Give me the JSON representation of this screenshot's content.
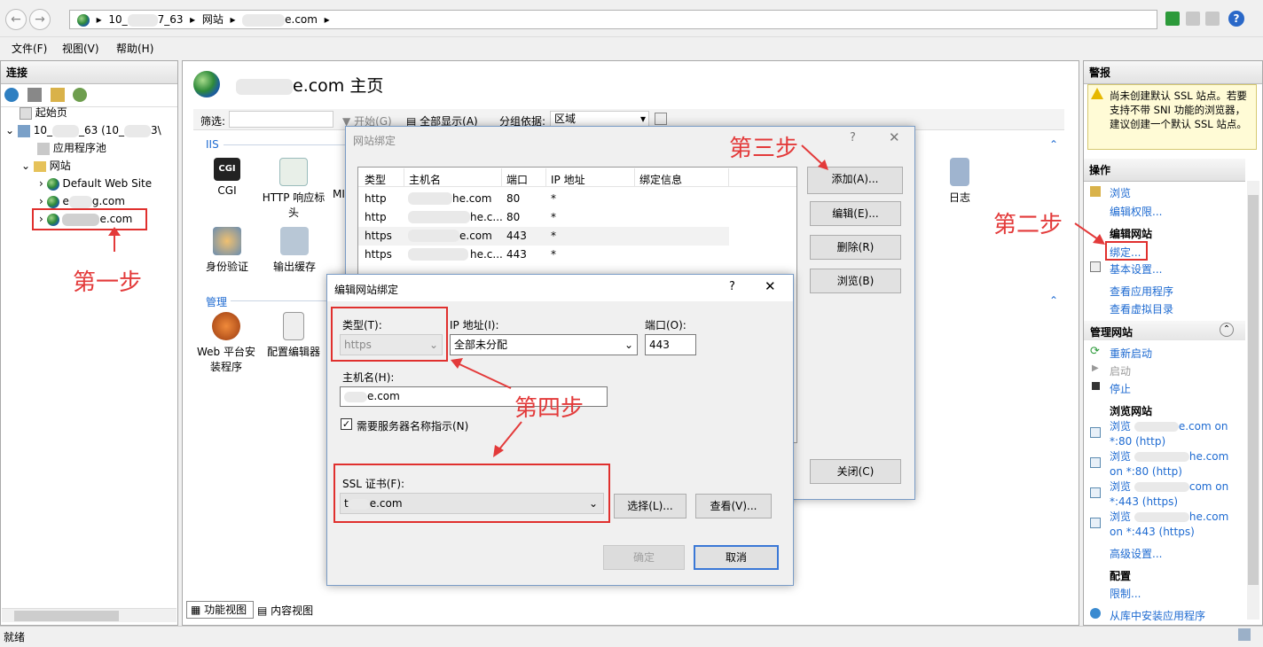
{
  "address_bar": {
    "segments": [
      "10_",
      "7_63",
      "网站",
      "e.com"
    ],
    "separator": "▸"
  },
  "menu": {
    "file": "文件(F)",
    "view": "视图(V)",
    "help": "帮助(H)"
  },
  "left_panel": {
    "title": "连接",
    "tree": {
      "start_page": "起始页",
      "server_a": "10_",
      "server_b": "_63 (10_",
      "server_c": "3\\",
      "app_pools": "应用程序池",
      "sites": "网站",
      "default_site": "Default Web Site",
      "site2_a": "e",
      "site2_b": "g.com",
      "site3": "e.com"
    }
  },
  "center": {
    "title_suffix": "e.com 主页",
    "filter_label": "筛选:",
    "start_btn": "开始(G)",
    "show_all": "全部显示(A)",
    "group_by_label": "分组依据:",
    "group_by_value": "区域",
    "section_iis": "IIS",
    "section_manage": "管理",
    "features": {
      "cgi": "CGI",
      "http_headers": "HTTP 响应标头",
      "mi": "MI",
      "log": "日志",
      "auth": "身份验证",
      "output_cache": "输出缓存",
      "web_platform": "Web 平台安装程序",
      "config_editor": "配置编辑器"
    },
    "bottom_tabs": {
      "features_view": "功能视图",
      "content_view": "内容视图"
    }
  },
  "site_bindings_dialog": {
    "title": "网站绑定",
    "help": "?",
    "columns": [
      "类型",
      "主机名",
      "端口",
      "IP 地址",
      "绑定信息"
    ],
    "rows": [
      {
        "type": "http",
        "host": "he.com",
        "port": "80",
        "ip": "*"
      },
      {
        "type": "http",
        "host": "he.c...",
        "port": "80",
        "ip": "*"
      },
      {
        "type": "https",
        "host": "e.com",
        "port": "443",
        "ip": "*"
      },
      {
        "type": "https",
        "host": "he.c...",
        "port": "443",
        "ip": "*"
      }
    ],
    "buttons": {
      "add": "添加(A)...",
      "edit": "编辑(E)...",
      "remove": "删除(R)",
      "browse": "浏览(B)",
      "close": "关闭(C)"
    }
  },
  "edit_binding_dialog": {
    "title": "编辑网站绑定",
    "help": "?",
    "type_label": "类型(T):",
    "type_value": "https",
    "ip_label": "IP 地址(I):",
    "ip_value": "全部未分配",
    "port_label": "端口(O):",
    "port_value": "443",
    "host_label": "主机名(H):",
    "host_value": "e.com",
    "sni_label": "需要服务器名称指示(N)",
    "ssl_label": "SSL 证书(F):",
    "ssl_value_a": "t",
    "ssl_value_b": "e.com",
    "select_btn": "选择(L)...",
    "view_btn": "查看(V)...",
    "ok_btn": "确定",
    "cancel_btn": "取消"
  },
  "right_panel": {
    "alerts_title": "警报",
    "alert_text": "尚未创建默认 SSL 站点。若要支持不带 SNI 功能的浏览器，建议创建一个默认 SSL 站点。",
    "actions_title": "操作",
    "browse": "浏览",
    "edit_perms": "编辑权限...",
    "edit_site_head": "编辑网站",
    "bindings": "绑定...",
    "basic_settings": "基本设置...",
    "view_apps": "查看应用程序",
    "view_vdirs": "查看虚拟目录",
    "manage_site_head": "管理网站",
    "restart": "重新启动",
    "start": "启动",
    "stop": "停止",
    "browse_site_head": "浏览网站",
    "browse1a": "浏览",
    "browse1b": "e.com on",
    "browse1c": "*:80 (http)",
    "browse2a": "浏览",
    "browse2b": "he.com",
    "browse2c": "on *:80 (http)",
    "browse3a": "浏览",
    "browse3b": "com on",
    "browse3c": "*:443 (https)",
    "browse4a": "浏览",
    "browse4b": "he.com",
    "browse4c": "on *:443 (https)",
    "advanced": "高级设置...",
    "config_head": "配置",
    "limits": "限制...",
    "install_app": "从库中安装应用程序"
  },
  "annotations": {
    "step1": "第一步",
    "step2": "第二步",
    "step3": "第三步",
    "step4": "第四步",
    "color": "#e33a3a"
  },
  "status_bar": {
    "text": "就绪"
  }
}
